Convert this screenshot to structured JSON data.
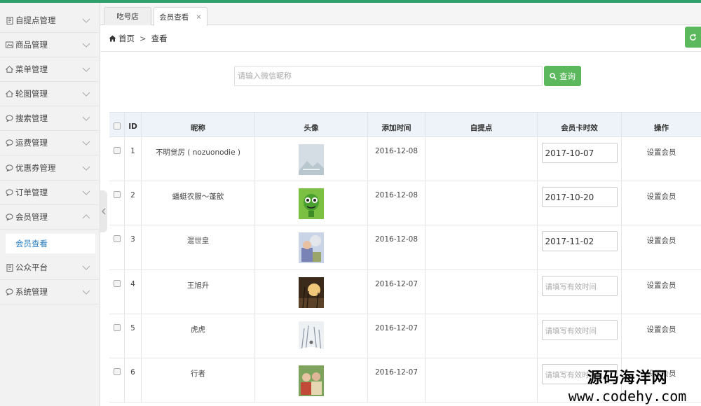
{
  "sidebar": {
    "items": [
      {
        "label": "自提点管理",
        "icon": "document-icon"
      },
      {
        "label": "商品管理",
        "icon": "picture-icon"
      },
      {
        "label": "菜单管理",
        "icon": "home-icon"
      },
      {
        "label": "轮图管理",
        "icon": "home-icon"
      },
      {
        "label": "搜索管理",
        "icon": "chat-icon"
      },
      {
        "label": "运费管理",
        "icon": "chat-icon"
      },
      {
        "label": "优惠券管理",
        "icon": "chat-icon"
      },
      {
        "label": "订单管理",
        "icon": "chat-icon"
      },
      {
        "label": "会员管理",
        "icon": "chat-icon",
        "expanded": true
      },
      {
        "label": "公众平台",
        "icon": "document-icon"
      },
      {
        "label": "系统管理",
        "icon": "chat-icon"
      }
    ],
    "active_sub": "会员查看"
  },
  "tabs": [
    {
      "label": "吃号店"
    },
    {
      "label": "会员查看",
      "close": "×"
    }
  ],
  "breadcrumb": {
    "home": "首页",
    "sep": ">",
    "current": "查看"
  },
  "search": {
    "placeholder": "请输入微信昵称",
    "button": "查询"
  },
  "table": {
    "columns": [
      "ID",
      "昵称",
      "头像",
      "添加时间",
      "自提点",
      "会员卡时效",
      "操作"
    ],
    "rows": [
      {
        "id": "1",
        "nickname": "不明觉厉 ( nozuonodie )",
        "added": "2016-12-08",
        "pickup": "",
        "expiry": "2017-10-07",
        "action": "设置会员"
      },
      {
        "id": "2",
        "nickname": "蟠蜓农服～蓬歆",
        "added": "2016-12-08",
        "pickup": "",
        "expiry": "2017-10-20",
        "action": "设置会员"
      },
      {
        "id": "3",
        "nickname": "混世皇",
        "added": "2016-12-08",
        "pickup": "",
        "expiry": "2017-11-02",
        "action": "设置会员"
      },
      {
        "id": "4",
        "nickname": "王旭升",
        "added": "2016-12-07",
        "pickup": "",
        "expiry": "",
        "action": "设置会员"
      },
      {
        "id": "5",
        "nickname": "虎虎",
        "added": "2016-12-07",
        "pickup": "",
        "expiry": "",
        "action": "设置会员"
      },
      {
        "id": "6",
        "nickname": "行者",
        "added": "2016-12-07",
        "pickup": "",
        "expiry": "",
        "action": "设置会员"
      }
    ],
    "expiry_placeholder": "请填写有效时间"
  },
  "watermark": {
    "line1": "源码海洋网",
    "line2": "www.codehy.com"
  },
  "colors": {
    "accent_green": "#5cb85c",
    "top_bar": "#2e9e6a",
    "active_link": "#2a7fc4"
  }
}
